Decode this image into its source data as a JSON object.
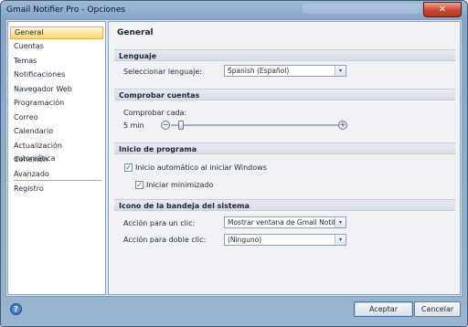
{
  "window": {
    "title": "Gmail Notifier Pro - Opciones",
    "close_glyph": "✕"
  },
  "sidebar": {
    "items": [
      {
        "label": "General",
        "selected": true
      },
      {
        "label": "Cuentas"
      },
      {
        "label": "Temas"
      },
      {
        "label": "Notificaciones"
      },
      {
        "label": "Navegador Web"
      },
      {
        "label": "Programación"
      },
      {
        "label": "Correo"
      },
      {
        "label": "Calendario"
      },
      {
        "label": "Actualización automática"
      },
      {
        "label": "Conexión"
      },
      {
        "label": "Avanzado"
      },
      {
        "label": "Registro"
      }
    ]
  },
  "general": {
    "title": "General",
    "lenguaje": {
      "header": "Lenguaje",
      "label": "Seleccionar lenguaje:",
      "value": "Spanish (Español)"
    },
    "comprobar": {
      "header": "Comprobar cuentas",
      "label": "Comprobar cada:",
      "value_text": "5 min",
      "minus": "−",
      "plus": "+",
      "slider_fraction": 0.06
    },
    "inicio": {
      "header": "Inicio de programa",
      "autostart_label": "Inicio automático al iniciar Windows",
      "autostart_checked": true,
      "minimized_label": "Iniciar minimizado",
      "minimized_checked": true,
      "check_glyph": "✓"
    },
    "tray": {
      "header": "Icono de la bandeja del sistema",
      "click_label": "Acción para un clic:",
      "click_value": "Mostrar ventana de Gmail Notifier P",
      "dblclick_label": "Acción para doble clic:",
      "dblclick_value": "(Ninguno)"
    },
    "combo_arrow": "▾"
  },
  "footer": {
    "help_glyph": "?",
    "accept_label": "Aceptar",
    "cancel_label": "Cancelar"
  },
  "colors": {
    "selected_item": "#ffd36b",
    "check": "#2a6e2a",
    "close_button": "#c9452e"
  }
}
